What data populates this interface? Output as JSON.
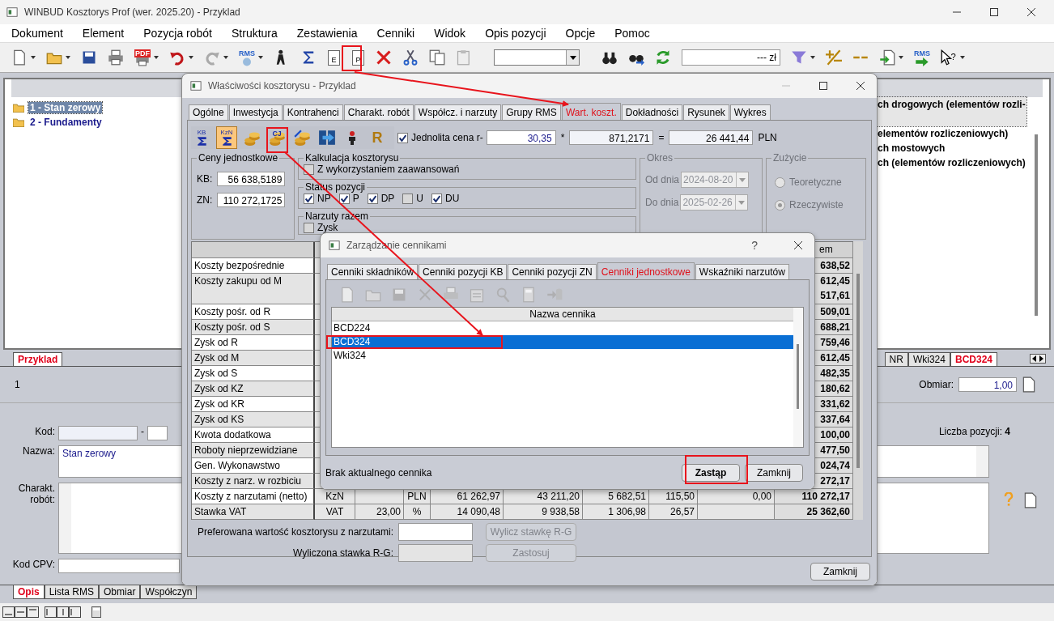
{
  "window": {
    "title": "WINBUD Kosztorys Prof (wer. 2025.20) - Przyklad"
  },
  "menu": [
    "Dokument",
    "Element",
    "Pozycja robót",
    "Struktura",
    "Zestawienia",
    "Cenniki",
    "Widok",
    "Opis pozycji",
    "Opcje",
    "Pomoc"
  ],
  "toolbar": [
    {
      "kind": "new",
      "menu": true
    },
    {
      "kind": "open",
      "menu": true
    },
    {
      "kind": "save",
      "menu": false
    },
    {
      "kind": "print",
      "menu": false
    },
    {
      "kind": "pdf",
      "label": "PDF",
      "menu": true
    },
    {
      "kind": "undo",
      "menu": true
    },
    {
      "kind": "redo",
      "menu": true
    },
    {
      "kind": "rms",
      "label": "RMS",
      "menu": true
    },
    {
      "kind": "walker",
      "menu": false
    },
    {
      "kind": "sigma",
      "menu": false
    },
    {
      "kind": "doc",
      "label": "E",
      "menu": false
    },
    {
      "kind": "doc",
      "label": "P",
      "menu": false
    },
    {
      "kind": "delete",
      "menu": false
    },
    {
      "kind": "cut",
      "menu": false
    },
    {
      "kind": "copy",
      "menu": false
    },
    {
      "kind": "paste",
      "menu": false
    },
    {
      "kind": "combo"
    },
    {
      "kind": "binoculars",
      "menu": false
    },
    {
      "kind": "binoculars-go",
      "menu": false
    },
    {
      "kind": "refresh",
      "menu": false
    },
    {
      "kind": "price",
      "value": "--- zł"
    },
    {
      "kind": "filter",
      "menu": true
    },
    {
      "kind": "plus-minus",
      "menu": false
    },
    {
      "kind": "minus-minus",
      "menu": false
    },
    {
      "kind": "import",
      "menu": true
    },
    {
      "kind": "rms-go",
      "label": "RMS",
      "menu": false
    },
    {
      "kind": "help",
      "label": "?",
      "menu": true
    }
  ],
  "tree": [
    {
      "label": "1 - Stan zerowy",
      "selected": true
    },
    {
      "label": "2 - Fundamenty",
      "selected": false
    }
  ],
  "description_lines": [
    "ch drogowych (elementów rozli-",
    "elementów  rozliczeniowych)",
    "ch mostowych",
    "ch (elementów  rozliczeniowych)"
  ],
  "document_tabs": [
    {
      "label": "Przyklad",
      "selected": true
    }
  ],
  "pricelist_tabs": [
    {
      "label": "NR",
      "selected": false
    },
    {
      "label": "Wki324",
      "selected": false
    },
    {
      "label": "BCD324",
      "selected": true
    }
  ],
  "position_number": "1",
  "quantity": {
    "label": "Obmiar:",
    "value": "1,00"
  },
  "form": {
    "code_label": "Kod:",
    "dash": "-",
    "name_label": "Nazwa:",
    "name_value": "Stan zerowy",
    "char_label": "Charakt. robót:",
    "cpv_label": "Kod CPV:",
    "count_label": "Liczba pozycji:",
    "count_value": "4"
  },
  "bottom_tabs": [
    {
      "label": "Opis",
      "selected": true
    },
    {
      "label": "Lista RMS",
      "selected": false
    },
    {
      "label": "Obmiar",
      "selected": false
    },
    {
      "label": "Współczyn",
      "selected": false
    }
  ],
  "properties_dialog": {
    "title": "Właściwości kosztorysu - Przyklad",
    "tabs": [
      {
        "label": "Ogólne",
        "selected": false
      },
      {
        "label": "Inwestycja",
        "selected": false
      },
      {
        "label": "Kontrahenci",
        "selected": false
      },
      {
        "label": "Charakt. robót",
        "selected": false
      },
      {
        "label": "Współcz. i narzuty",
        "selected": false
      },
      {
        "label": "Grupy RMS",
        "selected": false
      },
      {
        "label": "Wart. koszt.",
        "selected": true
      },
      {
        "label": "Dokładności",
        "selected": false
      },
      {
        "label": "Rysunek",
        "selected": false
      },
      {
        "label": "Wykres",
        "selected": false
      }
    ],
    "toolbar": [
      {
        "kind": "sum",
        "label": "KB",
        "selected": false
      },
      {
        "kind": "sum",
        "label": "KzN",
        "selected": true
      },
      {
        "kind": "coins",
        "selected": false
      },
      {
        "kind": "coins",
        "label": "CJ",
        "selected": false
      },
      {
        "kind": "coins-percent",
        "selected": false
      },
      {
        "kind": "film",
        "selected": false
      },
      {
        "kind": "person",
        "selected": false
      },
      {
        "kind": "letter",
        "label": "R",
        "selected": false
      }
    ],
    "uniform_price": {
      "label": "Jednolita cena r-",
      "checked": true,
      "price": "30,35",
      "times": "*",
      "quantity": "871,2171",
      "equals": "=",
      "total": "26 441,44",
      "currency": "PLN"
    },
    "unit_prices": {
      "title": "Ceny jednostkowe",
      "kb_label": "KB:",
      "kb": "56 638,5189",
      "zn_label": "ZN:",
      "zn": "110 272,1725"
    },
    "calculation": {
      "title": "Kalkulacja kosztorysu",
      "label": "Z wykorzystaniem zaawansowań",
      "checked": false
    },
    "status": {
      "title": "Status pozycji",
      "items": [
        {
          "label": "NP",
          "checked": true
        },
        {
          "label": "P",
          "checked": true
        },
        {
          "label": "DP",
          "checked": true
        },
        {
          "label": "U",
          "checked": false
        },
        {
          "label": "DU",
          "checked": true
        }
      ]
    },
    "surcharges": {
      "title": "Narzuty razem",
      "label": "Zysk",
      "checked": false
    },
    "period": {
      "title": "Okres",
      "disabled": true,
      "from_label": "Od dnia",
      "from": "2024-08-20",
      "to_label": "Do dnia",
      "to": "2025-02-26"
    },
    "usage": {
      "title": "Zużycie",
      "disabled": true,
      "options": [
        {
          "label": "Teoretyczne",
          "selected": false
        },
        {
          "label": "Rzeczywiste",
          "selected": true
        }
      ]
    },
    "table": {
      "header_total": "em",
      "rows": [
        {
          "label": "Koszty bezpośrednie",
          "totals": [
            "638,52"
          ]
        },
        {
          "label": "Koszty zakupu od M",
          "totals": [
            "612,45",
            "517,61"
          ]
        },
        {
          "label": "Koszty pośr. od R",
          "totals": [
            "509,01"
          ]
        },
        {
          "label": "Koszty pośr. od S",
          "totals": [
            "688,21"
          ]
        },
        {
          "label": "Zysk od R",
          "totals": [
            "759,46"
          ]
        },
        {
          "label": "Zysk od M",
          "totals": [
            "612,45"
          ]
        },
        {
          "label": "Zysk od S",
          "totals": [
            "482,35"
          ]
        },
        {
          "label": "Zysk od KZ",
          "totals": [
            "180,62"
          ]
        },
        {
          "label": "Zysk od KR",
          "totals": [
            "331,62"
          ]
        },
        {
          "label": "Zysk od KS",
          "totals": [
            "337,64"
          ]
        },
        {
          "label": "Kwota dodatkowa",
          "totals": [
            "100,00"
          ]
        },
        {
          "label": "Roboty nieprzewidziane",
          "totals": [
            "477,50"
          ]
        },
        {
          "label": "Gen. Wykonawstwo",
          "totals": [
            "024,74"
          ]
        },
        {
          "label": "Koszty z narz. w rozbiciu",
          "totals": [
            "272,17"
          ]
        },
        {
          "label": "Koszty z narzutami (netto)",
          "cells": [
            "KzN",
            null,
            "PLN",
            "61 262,97",
            "43 211,20",
            "5 682,51",
            "115,50",
            "0,00"
          ],
          "totals": [
            "110 272,17"
          ]
        },
        {
          "label": "Stawka VAT",
          "cells": [
            "VAT",
            "23,00",
            "%",
            "14 090,48",
            "9 938,58",
            "1 306,98",
            "26,57",
            null
          ],
          "totals": [
            "25 362,60"
          ]
        }
      ]
    },
    "preferred": {
      "label": "Preferowana wartość kosztorysu z narzutami:",
      "button": "Wylicz stawkę R-G",
      "disabled": true
    },
    "computed": {
      "label": "Wyliczona stawka R-G:",
      "button": "Zastosuj",
      "disabled": true
    },
    "close_button": "Zamknij"
  },
  "pricelist_dialog": {
    "title": "Zarządzanie cennikami",
    "help": "?",
    "tabs": [
      {
        "label": "Cenniki składników",
        "selected": false
      },
      {
        "label": "Cenniki pozycji KB",
        "selected": false
      },
      {
        "label": "Cenniki pozycji ZN",
        "selected": false
      },
      {
        "label": "Cenniki jednostkowe",
        "selected": true
      },
      {
        "label": "Wskaźniki narzutów",
        "selected": false
      }
    ],
    "toolbar": {
      "disabled": true,
      "items": [
        {
          "kind": "new"
        },
        {
          "kind": "open"
        },
        {
          "kind": "save"
        },
        {
          "kind": "delete"
        },
        {
          "kind": "print"
        },
        {
          "kind": "properties"
        },
        {
          "kind": "search"
        },
        {
          "kind": "calculator"
        },
        {
          "kind": "export"
        }
      ]
    },
    "column": "Nazwa cennika",
    "rows": [
      {
        "name": "BCD224",
        "selected": false
      },
      {
        "name": "BCD324",
        "selected": true
      },
      {
        "name": "Wki324",
        "selected": false
      }
    ],
    "status": "Brak aktualnego cennika",
    "replace_button": "Zastąp",
    "close_button": "Zamknij"
  }
}
